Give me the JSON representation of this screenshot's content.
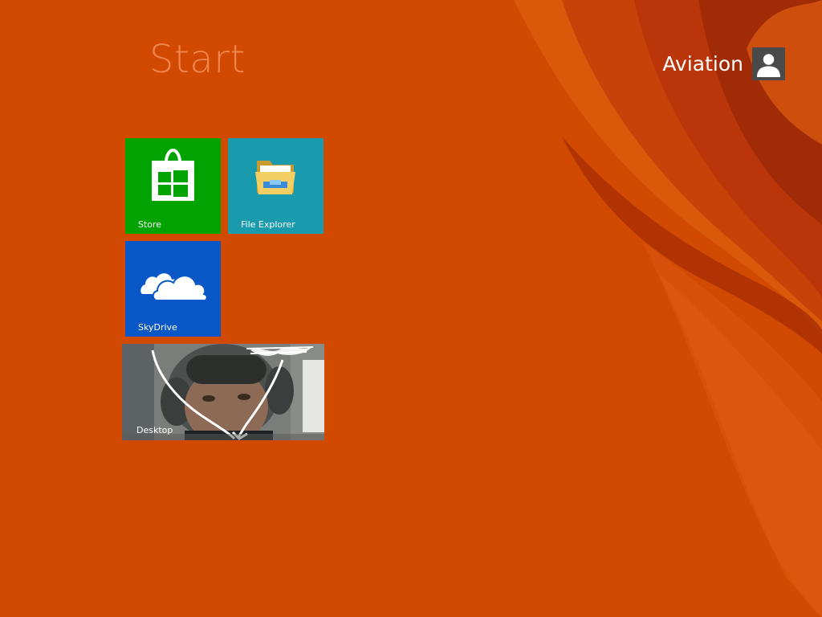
{
  "header": {
    "title": "Start"
  },
  "user": {
    "name": "Aviation",
    "avatar_icon": "user-silhouette-icon"
  },
  "tiles": [
    {
      "label": "Store",
      "icon": "store-bag-icon",
      "color": "#00a300"
    },
    {
      "label": "File Explorer",
      "icon": "folder-icon",
      "color": "#1a9aad"
    },
    {
      "label": "SkyDrive",
      "icon": "cloud-icon",
      "color": "#0a58c8"
    },
    {
      "label": "Desktop",
      "icon": "desktop-wallpaper-preview",
      "color": "#6a6f6e"
    }
  ],
  "theme": {
    "background": "#d24a02",
    "accent_dark": "#a8300a",
    "accent_light": "#e2651a"
  }
}
